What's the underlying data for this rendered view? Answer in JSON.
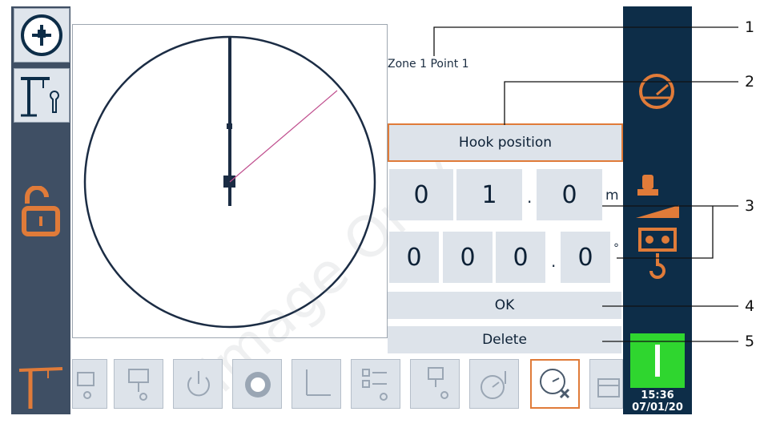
{
  "zone_label": "Zone 1 Point 1",
  "hook_button_label": "Hook position",
  "distance": {
    "digits": [
      "0",
      "1",
      "0"
    ],
    "separator": ".",
    "unit": "m"
  },
  "angle": {
    "digits": [
      "0",
      "0",
      "0",
      "0"
    ],
    "separator": ".",
    "unit": "°"
  },
  "ok_label": "OK",
  "delete_label": "Delete",
  "callouts": [
    "1",
    "2",
    "3",
    "4",
    "5"
  ],
  "clock": {
    "time": "15:36",
    "date": "07/01/20"
  },
  "watermark": "Image Only",
  "colors": {
    "accent": "#e07b39",
    "rail_left": "#3f4f64",
    "rail_right": "#0d2d48",
    "status_green": "#2fd62f",
    "radial_line": "#c0508f"
  },
  "left_rail_icons": [
    "crane-settings-icon",
    "crane-wrench-icon",
    "unlock-icon",
    "tower-crane-icon"
  ],
  "right_rail_icons": [
    "gauge-icon",
    "joystick-icon",
    "load-winch-icon"
  ],
  "toolbar_icons": [
    "trolley-limit-icon",
    "hoist-limit-icon",
    "power-icon",
    "speed-dial-icon",
    "axis-icon",
    "checklist-icon",
    "max-load-icon",
    "radius-gauge-icon",
    "radius-delete-icon",
    "calendar-icon"
  ]
}
